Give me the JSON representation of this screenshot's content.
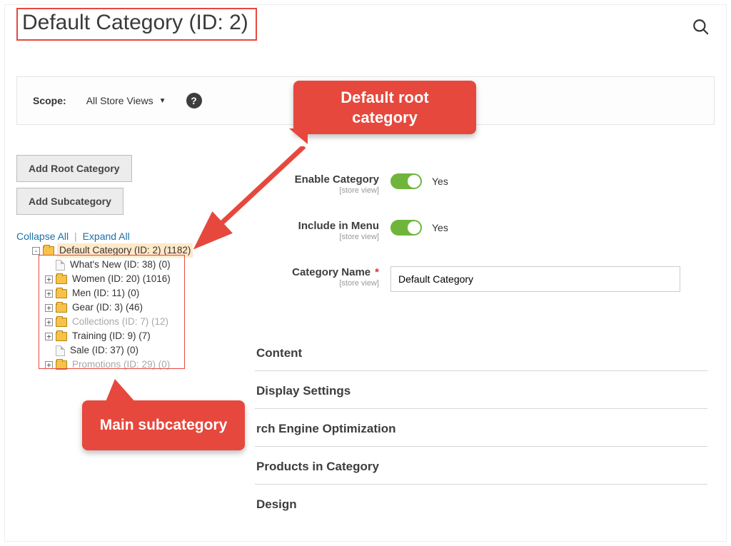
{
  "header": {
    "title": "Default Category (ID: 2)"
  },
  "scope": {
    "label": "Scope:",
    "value": "All Store Views"
  },
  "buttons": {
    "add_root": "Add Root Category",
    "add_sub": "Add Subcategory"
  },
  "tree_actions": {
    "collapse": "Collapse All",
    "expand": "Expand All"
  },
  "tree": {
    "root": "Default Category (ID: 2) (1182)",
    "whats_new": "What's New (ID: 38) (0)",
    "women": "Women (ID: 20) (1016)",
    "men": "Men (ID: 11) (0)",
    "gear": "Gear (ID: 3) (46)",
    "collections": "Collections (ID: 7) (12)",
    "training": "Training (ID: 9) (7)",
    "sale": "Sale (ID: 37) (0)",
    "promotions": "Promotions (ID: 29) (0)"
  },
  "form": {
    "enable_label": "Enable Category",
    "include_label": "Include in Menu",
    "name_label": "Category Name",
    "scope_note": "[store view]",
    "yes": "Yes",
    "name_value": "Default Category"
  },
  "sections": {
    "content": "Content",
    "display": "Display Settings",
    "seo": "rch Engine Optimization",
    "products": "Products in Category",
    "design": "Design"
  },
  "annotations": {
    "root_callout": "Default root category",
    "sub_callout": "Main subcategory"
  }
}
